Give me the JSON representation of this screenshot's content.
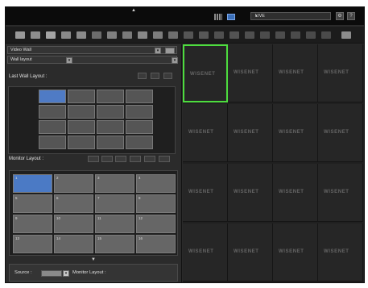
{
  "topbar": {
    "live_label": "LIVE",
    "chevron": "▾",
    "up_arrow": "▲",
    "buttons": [
      "settings-icon",
      "help-icon"
    ]
  },
  "left_panel": {
    "video_wall_label": "Video Wall",
    "wall_layout_label": "Wall layout",
    "last_wall_layout_label": "Last Wall Layout :",
    "monitor_layout_label": "Monitor Layout :",
    "source_label": "Source :",
    "monitor_layout_bottom_label": "Monitor Layout :",
    "cells": [
      "1",
      "2",
      "3",
      "4",
      "5",
      "6",
      "7",
      "8",
      "9",
      "10",
      "11",
      "12",
      "13",
      "14",
      "15",
      "16"
    ]
  },
  "tiles": [
    "WISENET",
    "WISENET",
    "WISENET",
    "WISENET",
    "WISENET",
    "WISENET",
    "WISENET",
    "WISENET",
    "WISENET",
    "WISENET",
    "WISENET",
    "WISENET",
    "WISENET",
    "WISENET",
    "WISENET",
    "WISENET"
  ],
  "colors": {
    "accent_blue": "#4f7bc5",
    "selected_green": "#4ddd3e"
  }
}
